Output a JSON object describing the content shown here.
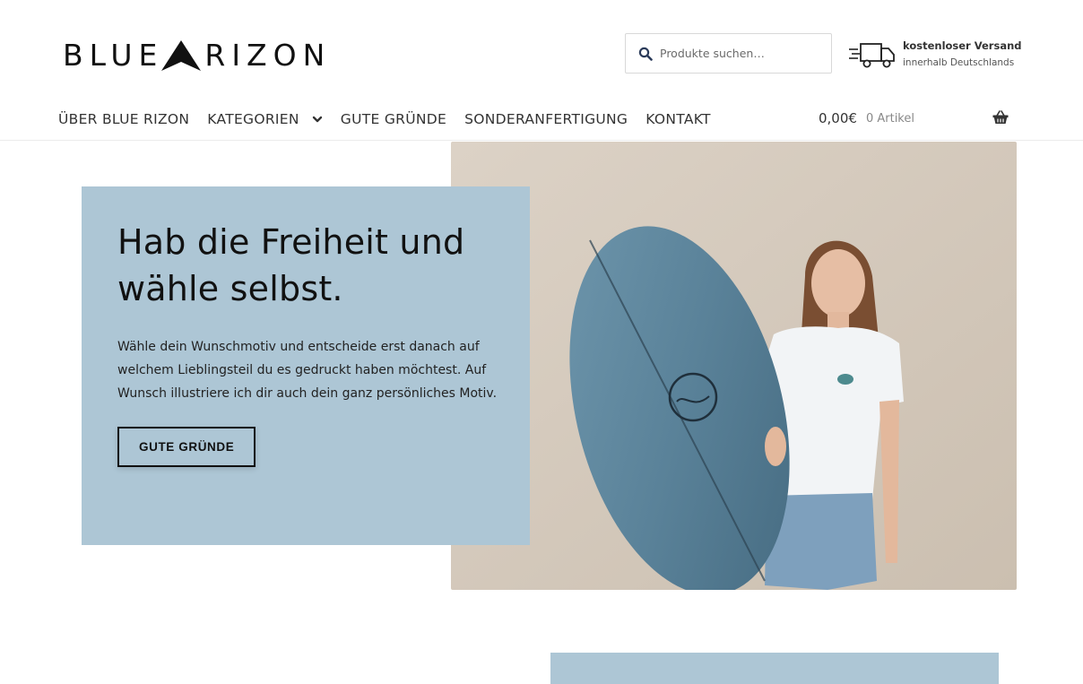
{
  "brand": {
    "name_left": "BLUE",
    "name_right": "RIZON",
    "logo_icon": "mountain-peak-icon"
  },
  "search": {
    "placeholder": "Produkte suchen…",
    "icon": "search-icon"
  },
  "shipping": {
    "title": "kostenloser Versand",
    "subtitle": "innerhalb Deutschlands",
    "icon": "truck-icon"
  },
  "nav": {
    "items": [
      {
        "label": "ÜBER BLUE RIZON"
      },
      {
        "label": "KATEGORIEN",
        "has_dropdown": true
      },
      {
        "label": "GUTE GRÜNDE"
      },
      {
        "label": "SONDERANFERTIGUNG"
      },
      {
        "label": "KONTAKT"
      }
    ]
  },
  "cart": {
    "amount": "0,00€",
    "count": "0 Artikel",
    "icon": "basket-icon"
  },
  "hero": {
    "title": "Hab die Freiheit und wähle selbst.",
    "text": "Wähle dein Wunschmotiv und entscheide erst danach auf welchem Lieblingsteil du es gedruckt haben möchtest. Auf Wunsch illustriere ich dir auch dein ganz persönliches Motiv.",
    "button_label": "GUTE GRÜNDE",
    "box_color": "#adc6d5"
  }
}
